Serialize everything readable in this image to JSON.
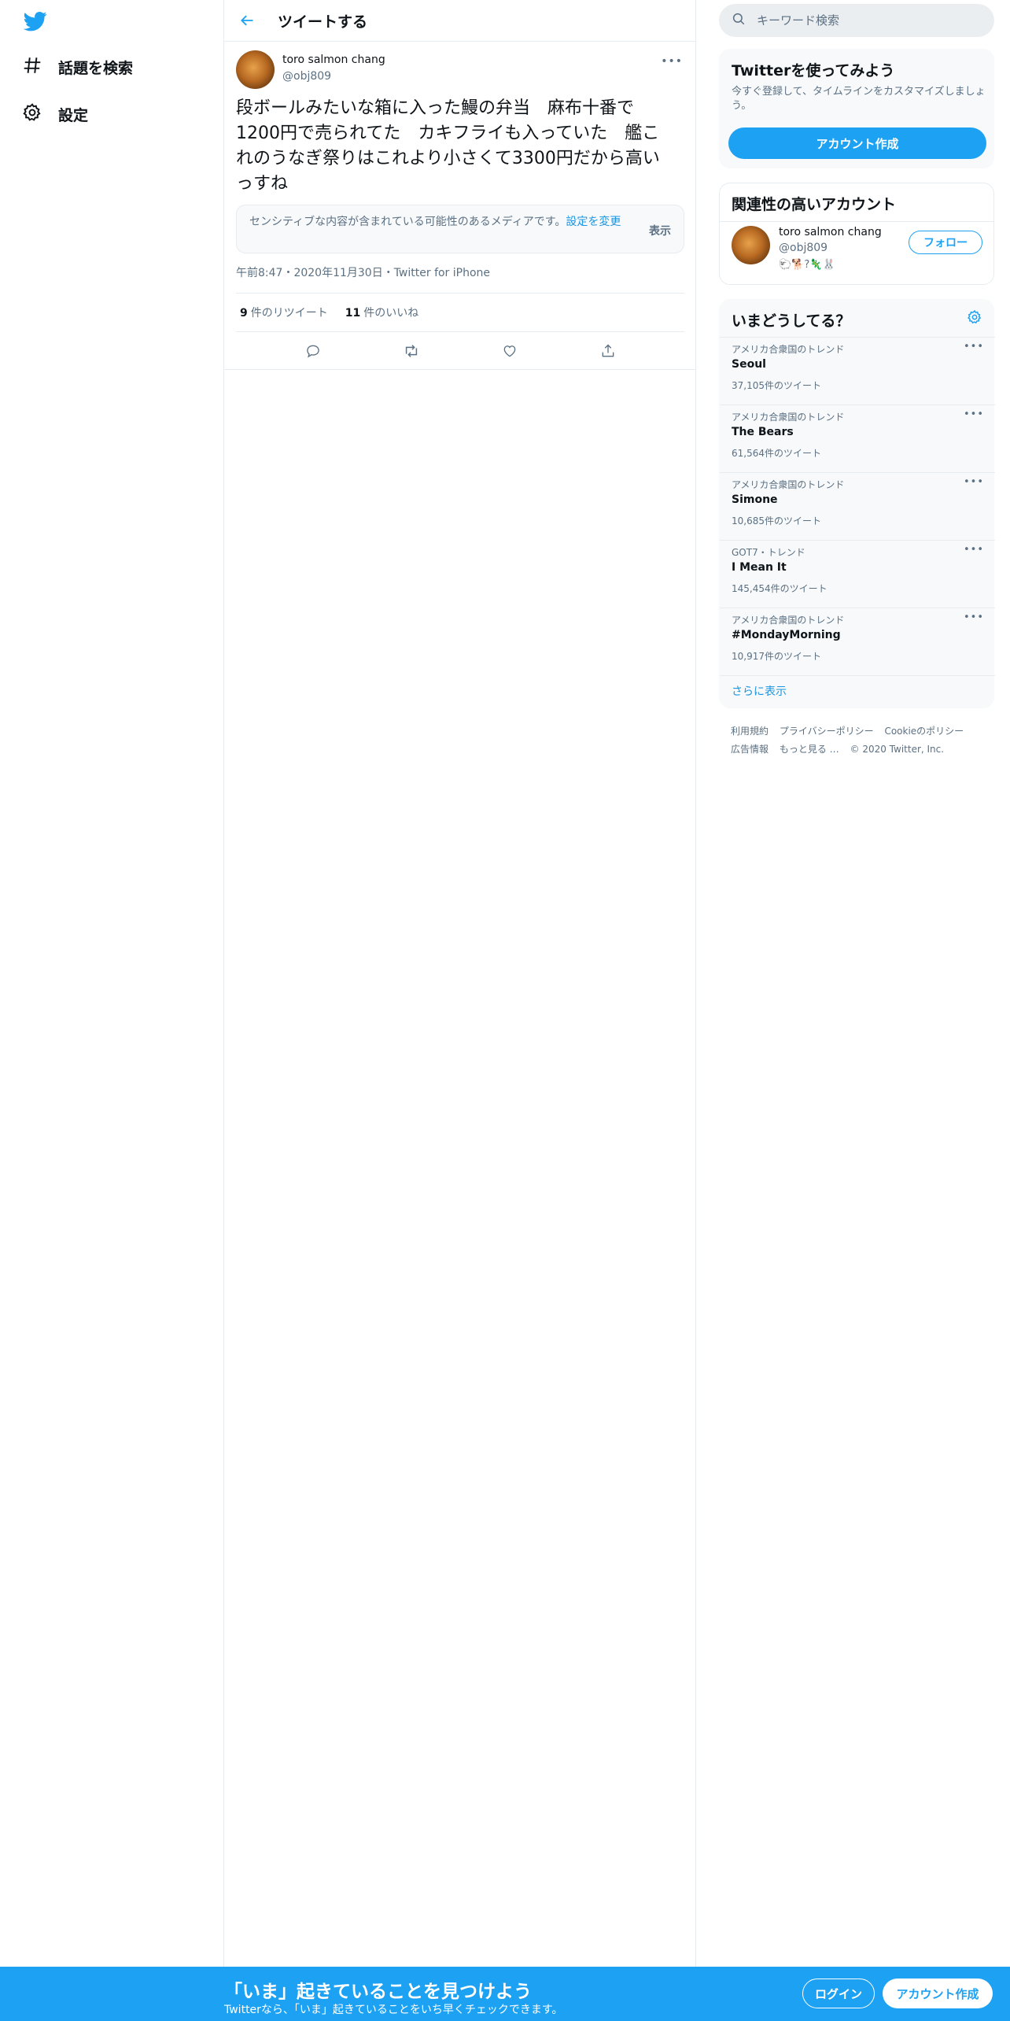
{
  "nav": {
    "items": [
      {
        "label": "話題を検索",
        "icon": "hashtag-icon"
      },
      {
        "label": "設定",
        "icon": "gear-icon"
      }
    ]
  },
  "main": {
    "title": "ツイートする"
  },
  "tweet": {
    "author_name": "toro salmon chang",
    "author_handle": "@obj809",
    "more": "•••",
    "text": "段ボールみたいな箱に入った鰻の弁当　麻布十番で1200円で売られてた　カキフライも入っていた　艦これのうなぎ祭りはこれより小さくて3300円だから高いっすね",
    "sensitive_message": "センシティブな内容が含まれている可能性のあるメディアです。",
    "sensitive_link": "設定を変更",
    "sensitive_show": "表示",
    "meta": "午前8:47・2020年11月30日・Twitter for iPhone",
    "retweet_count": "9",
    "retweet_label": "件のリツイート",
    "like_count": "11",
    "like_label": "件のいいね"
  },
  "search": {
    "placeholder": "キーワード検索"
  },
  "signup_box": {
    "title": "Twitterを使ってみよう",
    "description": "今すぐ登録して、タイムラインをカスタマイズしましょう。",
    "button": "アカウント作成"
  },
  "related": {
    "title": "関連性の高いアカウント",
    "name": "toro salmon chang",
    "handle": "@obj809",
    "bio_emoji": "🐑🐕?🦎🐰",
    "follow": "フォロー"
  },
  "trends": {
    "title": "いまどうしてる？",
    "items": [
      {
        "context": "アメリカ合衆国のトレンド",
        "name": "Seoul",
        "count": "37,105件のツイート"
      },
      {
        "context": "アメリカ合衆国のトレンド",
        "name": "The Bears",
        "count": "61,564件のツイート"
      },
      {
        "context": "アメリカ合衆国のトレンド",
        "name": "Simone",
        "count": "10,685件のツイート"
      },
      {
        "context": "GOT7・トレンド",
        "name": "I Mean It",
        "count": "145,454件のツイート"
      },
      {
        "context": "アメリカ合衆国のトレンド",
        "name": "#MondayMorning",
        "count": "10,917件のツイート"
      }
    ],
    "show_more": "さらに表示"
  },
  "footer": {
    "terms": "利用規約",
    "privacy": "プライバシーポリシー",
    "cookies": "Cookieのポリシー",
    "ads": "広告情報",
    "more": "もっと見る …",
    "copyright": "© 2020 Twitter, Inc."
  },
  "bottom_bar": {
    "title": "「いま」起きていることを見つけよう",
    "subtitle": "Twitterなら、「いま」起きていることをいち早くチェックできます。",
    "login": "ログイン",
    "signup": "アカウント作成"
  },
  "colors": {
    "accent": "#1da1f2",
    "link": "#1b95e0",
    "secondary_text": "#5b7083",
    "border": "#e6ecf0"
  }
}
